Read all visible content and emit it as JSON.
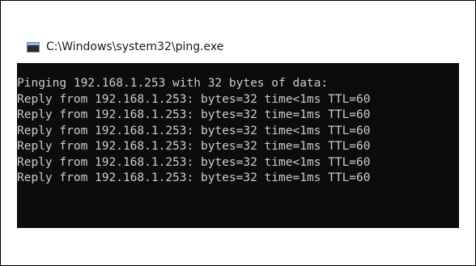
{
  "window": {
    "title": "C:\\Windows\\system32\\ping.exe",
    "icon": "console-app-icon"
  },
  "console": {
    "header": "Pinging 192.168.1.253 with 32 bytes of data:",
    "replies": [
      "Reply from 192.168.1.253: bytes=32 time<1ms TTL=60",
      "Reply from 192.168.1.253: bytes=32 time=1ms TTL=60",
      "Reply from 192.168.1.253: bytes=32 time<1ms TTL=60",
      "Reply from 192.168.1.253: bytes=32 time=1ms TTL=60",
      "Reply from 192.168.1.253: bytes=32 time<1ms TTL=60",
      "Reply from 192.168.1.253: bytes=32 time=1ms TTL=60"
    ]
  },
  "colors": {
    "console_background": "#0c0c0c",
    "console_text": "#cccccc",
    "titlebar_background": "#ffffff"
  }
}
